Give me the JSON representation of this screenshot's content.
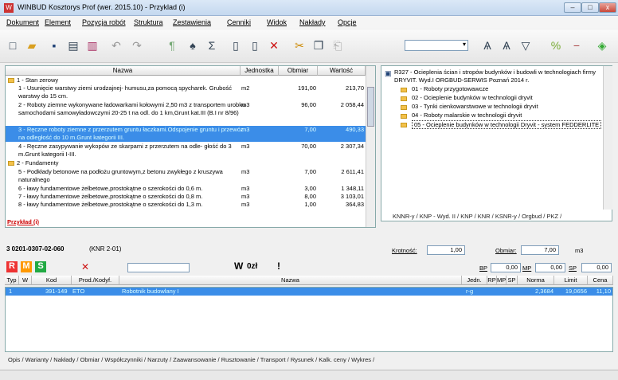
{
  "window": {
    "title": "WINBUD Kosztorys Prof (wer. 2015.10) - Przyklad (i)",
    "min": "–",
    "max": "□",
    "close": "x"
  },
  "menu": [
    "Dokument",
    "Element",
    "Pozycja robót",
    "Struktura",
    "Zestawienia",
    "Cenniki",
    "Widok",
    "Nakłady",
    "Opcje"
  ],
  "grid": {
    "headers": [
      "Nazwa",
      "Jednostka",
      "Obmiar",
      "Wartość"
    ],
    "rows": [
      {
        "name": "1 - Stan zerowy",
        "j": "",
        "o": "",
        "w": ""
      },
      {
        "name": "1 - Usunięcie warstwy ziemi urodzajnej- humusu,za pomocą spycharek. Grubość warstwy do 15 cm.",
        "j": "m2",
        "o": "191,00",
        "w": "213,70"
      },
      {
        "name": "2 - Roboty ziemne wykonywane ładowarkami kołowymi 2,50 m3 z transportem urobku samochodami samowyładowczymi 20-25 t na odl. do 1 km,Grunt kat.III (B.I nr 8/96)",
        "j": "m3",
        "o": "96,00",
        "w": "2 058,44"
      },
      {
        "name": "3 - Ręczne roboty ziemne z przerzutem gruntu łaczkami.Odspojenie gruntu i przewóz na odległość do 10 m.Grunt kategorii III.",
        "j": "m3",
        "o": "7,00",
        "w": "490,33"
      },
      {
        "name": "4 - Ręczne zasypywanie wykopów ze skarpami z przerzutem na odle- głość do 3 m.Grunt kategorii I-III.",
        "j": "m3",
        "o": "70,00",
        "w": "2 307,34"
      },
      {
        "name": "2 - Fundamenty",
        "j": "",
        "o": "",
        "w": ""
      },
      {
        "name": "5 - Podkłady betonowe na podłożu gruntowym,z betonu zwykłego z kruszywa naturalnego",
        "j": "m3",
        "o": "7,00",
        "w": "2 611,41"
      },
      {
        "name": "6 - ławy fundamentowe żelbetowe,prostokątne o szerokości do 0,6 m.",
        "j": "m3",
        "o": "3,00",
        "w": "1 348,11"
      },
      {
        "name": "7 - ławy fundamentowe żelbetowe,prostokątne o szerokości do 0,8 m.",
        "j": "m3",
        "o": "8,00",
        "w": "3 103,01"
      },
      {
        "name": "8 - ławy fundamentowe żelbetowe,prostokątne o szerokości do 1,3 m.",
        "j": "m3",
        "o": "1,00",
        "w": "364,83"
      }
    ],
    "tab": "Przykład (i)"
  },
  "right": {
    "title": "R327 - Ocieplenia ścian i stropów budynków i budowli w technologiach firmy DRYVIT. Wyd.I ORGBUD-SERWIS Poznań 2014 r.",
    "items": [
      "01 - Roboty przygotowawcze",
      "02 - Ocieplenie budynków w technologii dryvit",
      "03 - Tynki cienkowarstwowe w technologii dryvit",
      "04 - Roboty malarskie w technologii dryvit",
      "05 - Ocieplenie budynków w technologii Dryvit - system FEDDERLITE"
    ],
    "tabs": "KNNR-y / KNP - Wyd. II / KNP / KNR / KSNR-y / Orgbud / PKZ /"
  },
  "position": {
    "code": "3  0201-0307-02-060",
    "ref": "(KNR 2-01)",
    "krot_label": "Krotność:",
    "krot": "1,00",
    "obm_label": "Obmiar:",
    "obm": "7,00",
    "unit": "m3"
  },
  "params": {
    "bp_label": "BP",
    "bp": "0,00",
    "mp_label": "MP",
    "mp": "0,00",
    "sp_label": "SP",
    "sp": "0,00",
    "pct": "%"
  },
  "lower": {
    "headers": [
      "Typ",
      "W",
      "Kod",
      "Prod./Kodyf.",
      "Nazwa",
      "Jedn.",
      "RP",
      "MP",
      "SP",
      "Norma",
      "Limit",
      "Cena"
    ],
    "row": {
      "nr": "1",
      "kod": "391-149",
      "prod": "ETO",
      "nazwa": "Robotnik budowlany I",
      "jedn": "r-g",
      "norma": "2,3684",
      "limit": "19,0656",
      "cena": "11,10"
    },
    "tabs": "Opis / Warianty / Nakłady / Obmiar / Współczynniki / Narzuty / Zaawansowanie / Rusztowanie / Transport / Rysunek / Kalk. ceny / Wykres /"
  },
  "toolbar2": {
    "w": "W",
    "oz": "0zł",
    "bang": "!"
  }
}
